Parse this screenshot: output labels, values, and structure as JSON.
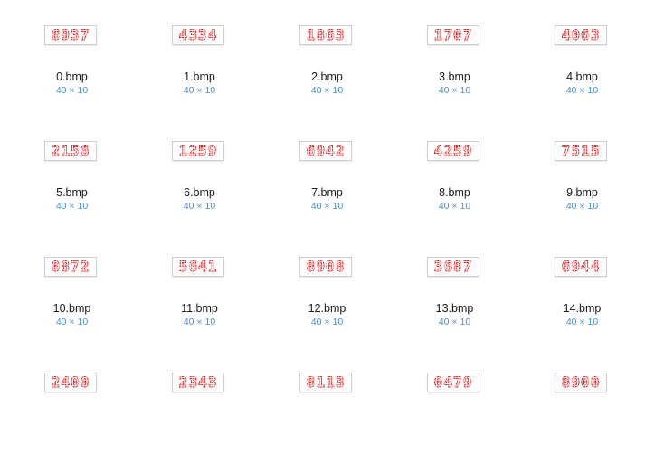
{
  "files": [
    {
      "name": "0.bmp",
      "dims": "40 × 10",
      "digits": "6937"
    },
    {
      "name": "1.bmp",
      "dims": "40 × 10",
      "digits": "4334"
    },
    {
      "name": "2.bmp",
      "dims": "40 × 10",
      "digits": "1863"
    },
    {
      "name": "3.bmp",
      "dims": "40 × 10",
      "digits": "1707"
    },
    {
      "name": "4.bmp",
      "dims": "40 × 10",
      "digits": "4063"
    },
    {
      "name": "5.bmp",
      "dims": "40 × 10",
      "digits": "2156"
    },
    {
      "name": "6.bmp",
      "dims": "40 × 10",
      "digits": "1259"
    },
    {
      "name": "7.bmp",
      "dims": "40 × 10",
      "digits": "6942"
    },
    {
      "name": "8.bmp",
      "dims": "40 × 10",
      "digits": "4259"
    },
    {
      "name": "9.bmp",
      "dims": "40 × 10",
      "digits": "7515"
    },
    {
      "name": "10.bmp",
      "dims": "40 × 10",
      "digits": "0872"
    },
    {
      "name": "11.bmp",
      "dims": "40 × 10",
      "digits": "5641"
    },
    {
      "name": "12.bmp",
      "dims": "40 × 10",
      "digits": "8908"
    },
    {
      "name": "13.bmp",
      "dims": "40 × 10",
      "digits": "3687"
    },
    {
      "name": "14.bmp",
      "dims": "40 × 10",
      "digits": "6944"
    },
    {
      "name": "",
      "dims": "",
      "digits": "2400"
    },
    {
      "name": "",
      "dims": "",
      "digits": "2343"
    },
    {
      "name": "",
      "dims": "",
      "digits": "8113"
    },
    {
      "name": "",
      "dims": "",
      "digits": "0479"
    },
    {
      "name": "",
      "dims": "",
      "digits": "8900"
    }
  ],
  "colors": {
    "digit_red": "#ee2222",
    "dims_blue": "#4a8fd6"
  }
}
